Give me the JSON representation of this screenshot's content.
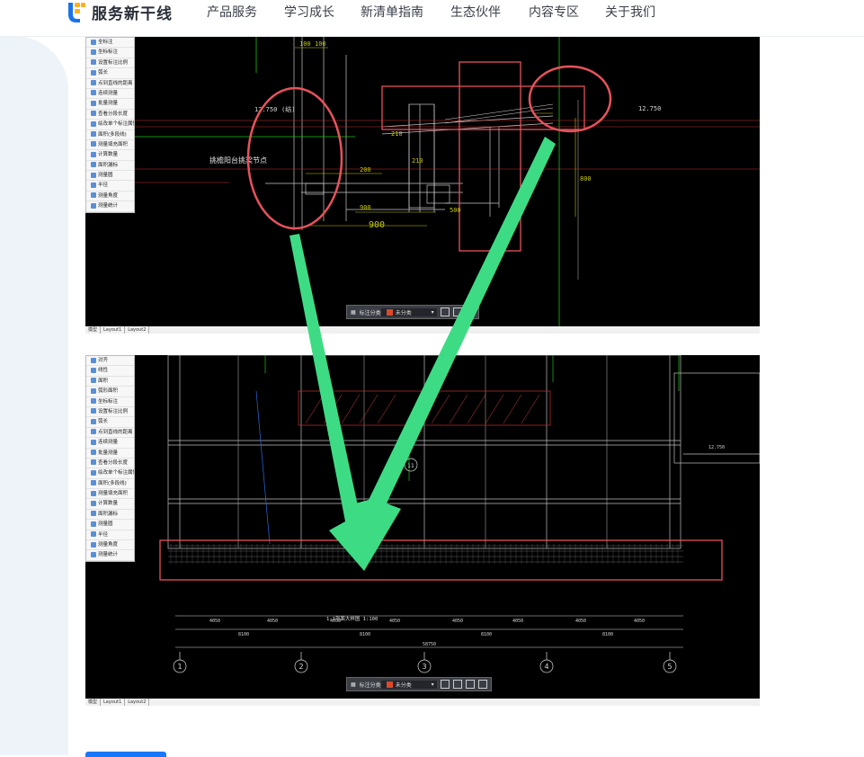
{
  "brand": {
    "name": "服务新干线"
  },
  "nav": [
    "产品服务",
    "学习成长",
    "新清单指南",
    "生态伙伴",
    "内容专区",
    "关于我们"
  ],
  "cad_top": {
    "palette": [
      "全标注",
      "坐标标注",
      "设置标注比例",
      "弧长",
      "点到直线的距离",
      "连续测量",
      "批量测量",
      "查看分段长度",
      "绘改单个标注属性",
      "面积(多段线)",
      "测量填充面积",
      "计算数量",
      "面积漏标",
      "测量圆",
      "半径",
      "测量角度",
      "测量统计"
    ],
    "tabs": [
      "模型",
      "Layout1",
      "Layout2"
    ],
    "toolbar": {
      "label": "标注分类",
      "select": "未分类"
    },
    "texts": {
      "elev_left": "12.750",
      "paren": "(结)",
      "elev_right": "12.750",
      "annotation": "挑檐阳台挑梁节点",
      "dim_100a": "100",
      "dim_100b": "100",
      "dim_200": "200",
      "dim_900a": "900",
      "dim_900b": "900",
      "dim_500": "500",
      "dim_210a": "210",
      "dim_210b": "210",
      "dim_800": "800"
    }
  },
  "cad_bottom": {
    "palette": [
      "对齐",
      "线性",
      "面积",
      "弧形面积",
      "坐标标注",
      "设置标注比例",
      "弧长",
      "点到直线的距离",
      "连续测量",
      "批量测量",
      "查看分段长度",
      "绘改单个标注属性",
      "面积(多段线)",
      "测量填充面积",
      "计算数量",
      "面积漏标",
      "测量圆",
      "半径",
      "测量角度",
      "测量统计"
    ],
    "tabs": [
      "模型",
      "Layout1",
      "Layout2"
    ],
    "toolbar": {
      "label": "标注分类",
      "select": "未分类"
    },
    "axes": [
      "1",
      "2",
      "3",
      "4",
      "5"
    ],
    "dims": [
      "4050",
      "4050",
      "4050",
      "4050",
      "4050",
      "4050",
      "4050",
      "4050",
      "4050",
      "4050"
    ],
    "dims2": [
      "8100",
      "8100",
      "8100",
      "8100",
      "8100",
      "8100"
    ],
    "total": "58750",
    "bubble": "11",
    "elev": "12.750",
    "note": "1-1剖面大样图 1:100"
  },
  "colors": {
    "overlay_red": "#e8525c",
    "arrow_green": "#3ddc84",
    "cad_bg": "#000000"
  }
}
